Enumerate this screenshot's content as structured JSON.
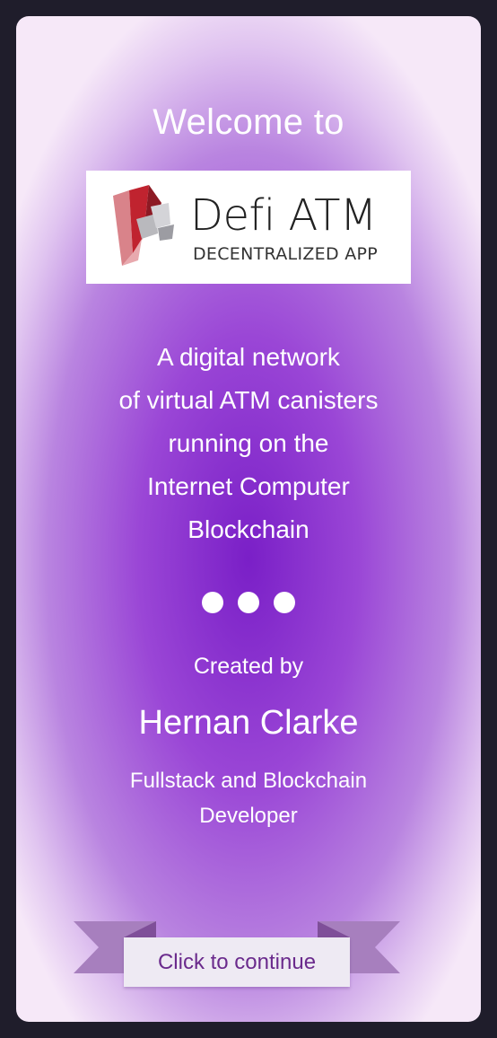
{
  "welcome": {
    "title": "Welcome to"
  },
  "logo": {
    "name": "Defi ATM",
    "subtitle": "DECENTRALIZED APP"
  },
  "description": {
    "lines": [
      "A digital network",
      "of virtual ATM canisters",
      "running on the",
      "Internet Computer",
      "Blockchain"
    ]
  },
  "author": {
    "created_label": "Created by",
    "name": "Hernan Clarke",
    "role_lines": [
      "Fullstack and Blockchain",
      "Developer"
    ]
  },
  "actions": {
    "continue_label": "Click to continue"
  },
  "colors": {
    "accent": "#7a1fc7",
    "background": "#1f1d2b",
    "button_text": "#6a2a8c",
    "ribbon": "#a77fbe"
  },
  "icons": {
    "logo": "defi-atm-logo-icon",
    "dots": "ellipsis-dots-icon"
  }
}
